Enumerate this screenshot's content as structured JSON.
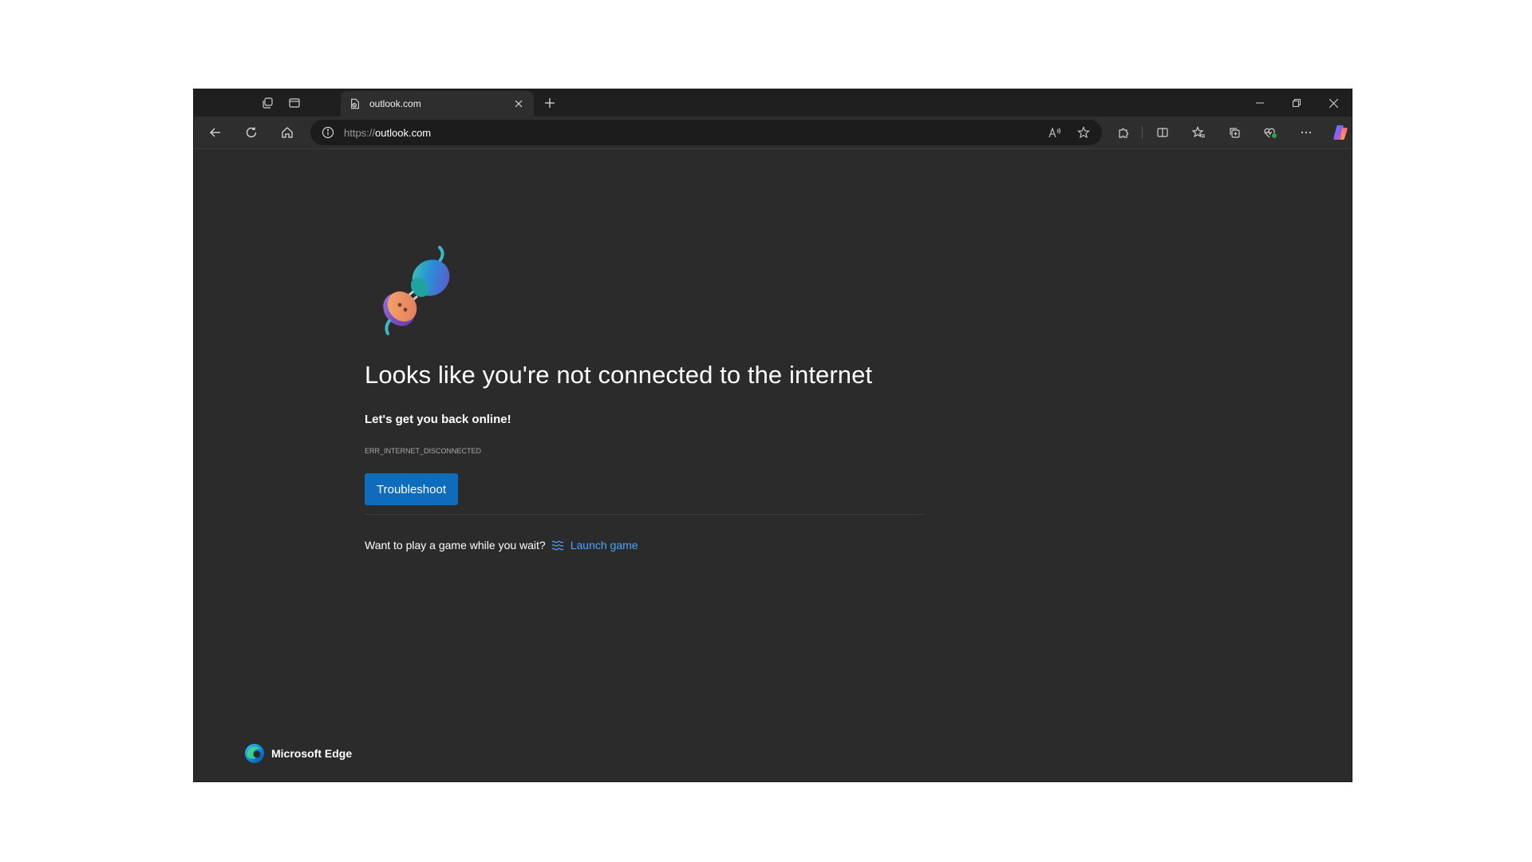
{
  "browser": {
    "tab": {
      "title": "outlook.com",
      "favicon": "page-error-icon"
    },
    "address_bar": {
      "scheme": "https://",
      "host": "outlook.com"
    },
    "icons": {
      "workspaces": "workspaces-icon",
      "tab_actions": "tab-actions-icon",
      "new_tab": "plus-icon",
      "minimize": "minimize-icon",
      "restore": "restore-icon",
      "close": "close-icon",
      "back": "back-arrow-icon",
      "refresh": "refresh-icon",
      "home": "home-icon",
      "site_info": "info-icon",
      "read_aloud": "read-aloud-icon",
      "favorite": "star-icon",
      "extensions": "puzzle-icon",
      "split_screen": "split-screen-icon",
      "favorites": "favorites-icon",
      "collections": "collections-icon",
      "browser_essentials": "heart-pulse-icon",
      "more": "ellipsis-icon",
      "copilot": "copilot-icon"
    }
  },
  "error_page": {
    "heading": "Looks like you're not connected to the internet",
    "subheading": "Let's get you back online!",
    "error_code": "ERR_INTERNET_DISCONNECTED",
    "troubleshoot_label": "Troubleshoot",
    "game_prompt": "Want to play a game while you wait?",
    "game_link": "Launch game",
    "illustration": "unplugged-plug-illustration"
  },
  "footer": {
    "brand_name": "Microsoft Edge",
    "brand_logo": "edge-logo"
  },
  "colors": {
    "accent_button": "#0f6cbd",
    "link": "#4aa3ff",
    "page_background": "#2b2b2b",
    "titlebar": "#1f1f1f"
  }
}
